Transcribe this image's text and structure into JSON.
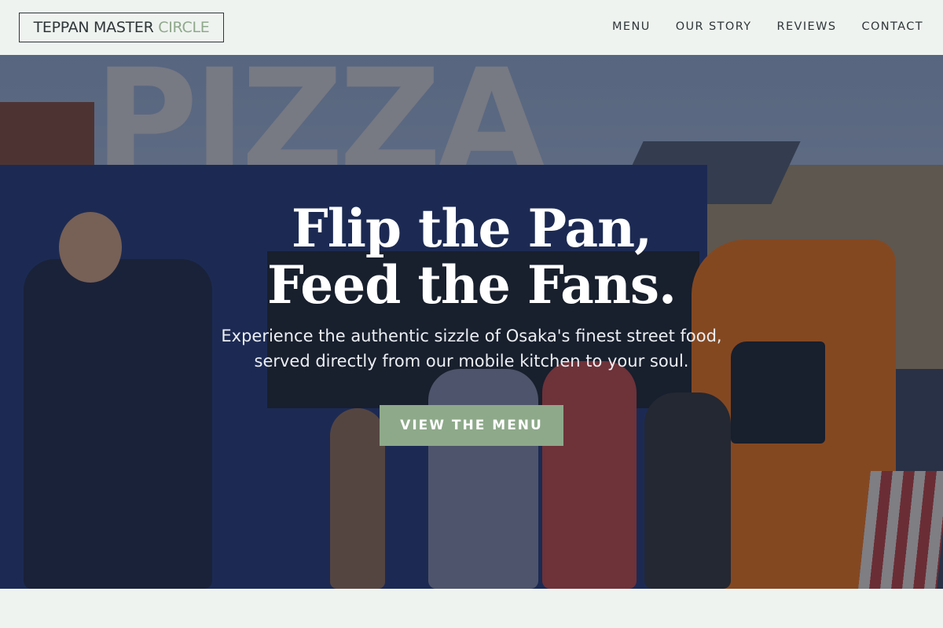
{
  "brand": {
    "name_part1": "TEPPAN MASTER",
    "name_part2": "CIRCLE"
  },
  "nav": {
    "items": [
      {
        "label": "MENU"
      },
      {
        "label": "OUR STORY"
      },
      {
        "label": "REVIEWS"
      },
      {
        "label": "CONTACT"
      }
    ]
  },
  "hero": {
    "headline_line1": "Flip the Pan,",
    "headline_line2": "Feed the Fans.",
    "subtitle": "Experience the authentic sizzle of Osaka's finest street food, served directly from our mobile kitchen to your soul.",
    "cta_label": "VIEW THE MENU",
    "background_sign_text": "PIZZA"
  },
  "colors": {
    "accent": "#8ea98a",
    "text_dark": "#2f3638",
    "page_bg": "#eff3f0"
  }
}
